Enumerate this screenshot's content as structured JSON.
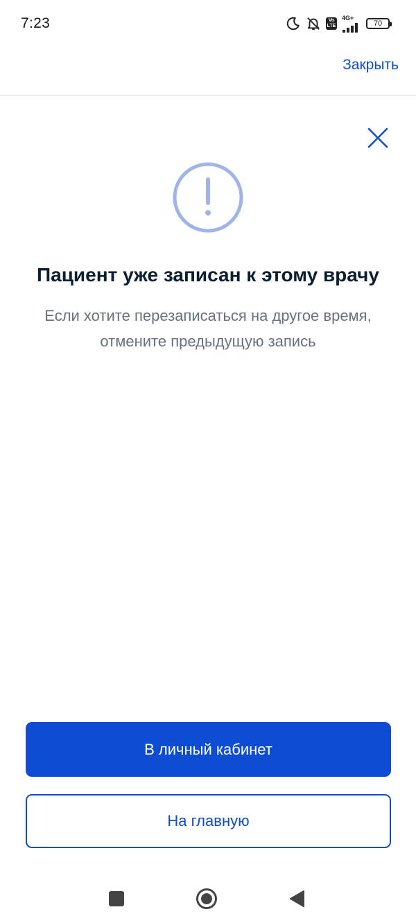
{
  "status_bar": {
    "time": "7:23",
    "battery": "70",
    "network": "4G+",
    "volte_top": "Vo",
    "volte_bottom": "LTE"
  },
  "app_bar": {
    "close_label": "Закрыть"
  },
  "dialog": {
    "title": "Пациент уже записан к этому врачу",
    "subtitle": "Если хотите перезаписаться на другое время, отмените предыдущую запись"
  },
  "actions": {
    "primary_label": "В личный кабинет",
    "secondary_label": "На главную"
  },
  "colors": {
    "accent": "#0d4cd3",
    "icon_ring": "#9fb5ea",
    "title": "#0b1f33",
    "subtitle": "#66727f"
  },
  "icons": {
    "moon": "moon-icon",
    "bell_off": "bell-off-icon",
    "signal": "signal-icon",
    "battery": "battery-icon",
    "close": "close-icon",
    "alert": "exclamation-circle-icon",
    "nav_recent": "square-icon",
    "nav_home": "circle-icon",
    "nav_back": "triangle-back-icon"
  }
}
